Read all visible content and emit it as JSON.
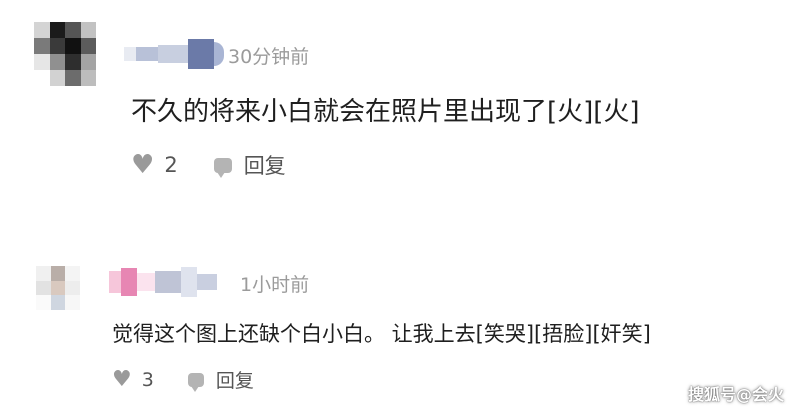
{
  "comments": [
    {
      "time": "30分钟前",
      "text": "不久的将来小白就会在照片里出现了[火][火]",
      "likes": "2",
      "reply_label": "回复"
    },
    {
      "time": "1小时前",
      "text": "觉得这个图上还缺个白小白。 让我上去[笑哭][捂脸][奸笑]",
      "likes": "3",
      "reply_label": "回复"
    }
  ],
  "icons": {
    "like": "heart-icon",
    "reply": "speech-bubble-icon"
  },
  "watermark": "搜狐号@会火",
  "colors": {
    "time": "#9b9b9b",
    "text": "#1f1f1f",
    "icon": "#9a9a9a"
  }
}
